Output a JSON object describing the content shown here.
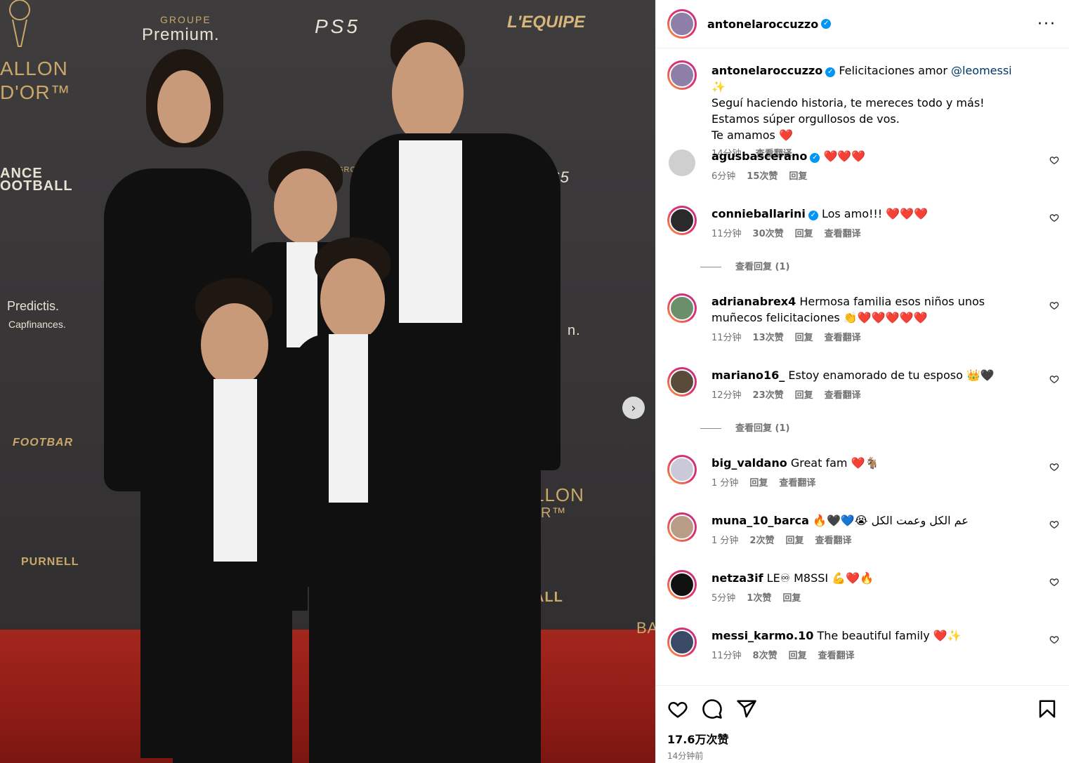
{
  "post": {
    "username": "antonelaroccuzzo",
    "more_icon": "more-horizontal-icon",
    "caption": {
      "username": "antonelaroccuzzo",
      "line1_text": "Felicitaciones amor",
      "mention": "@leomessi",
      "line1_emoji": "✨",
      "line2": "Seguí haciendo historia, te mereces todo y más!",
      "line3": "Estamos súper orgullosos de vos.",
      "line4_text": "Te amamos",
      "line4_emoji": "❤️",
      "time": "14分钟",
      "translate": "查看翻译"
    },
    "likes": "17.6万次赞",
    "timestamp": "14分钟前"
  },
  "photo": {
    "logos": {
      "groupe": "GROUPE",
      "premium": "Premium.",
      "ps5": "PS5",
      "lequipe": "L'EQUIPE",
      "ballon1": "ALLON",
      "ballon2": "D'OR™",
      "france1": "ANCE",
      "france2": "OOTBALL",
      "predictis": "Predictis.",
      "capfinances": "Capfinances.",
      "footbar": "FOOTBAR",
      "purnell": "PURNELL",
      "groupe_small": "GROUPE",
      "ps5_small": "S5",
      "n_dot": "n.",
      "ballon_r1": "LLON",
      "ballon_r2": "R™",
      "football_r1": "F",
      "football_r2": "ALL",
      "ba": "BA"
    }
  },
  "comments": [
    {
      "username": "agusbascerano",
      "verified": true,
      "text": "❤️❤️❤️",
      "time": "6分钟",
      "likes": "15次赞",
      "reply": "回复",
      "translate": ""
    },
    {
      "username": "connieballarini",
      "verified": true,
      "text": "Los amo!!! ❤️❤️❤️",
      "time": "11分钟",
      "likes": "30次赞",
      "reply": "回复",
      "translate": "查看翻译",
      "view_replies": "查看回复 (1)"
    },
    {
      "username": "adrianabrex4",
      "verified": false,
      "text": "Hermosa familia esos niños unos muñecos felicitaciones 👏❤️❤️❤️❤️❤️",
      "time": "11分钟",
      "likes": "13次赞",
      "reply": "回复",
      "translate": "查看翻译"
    },
    {
      "username": "mariano16_",
      "verified": false,
      "text": "Estoy enamorado de tu esposo 👑🖤",
      "time": "12分钟",
      "likes": "23次赞",
      "reply": "回复",
      "translate": "查看翻译",
      "view_replies": "查看回复 (1)"
    },
    {
      "username": "big_valdano",
      "verified": false,
      "text": "Great fam ❤️🐐",
      "time": "1 分钟",
      "likes": "",
      "reply": "回复",
      "translate": "查看翻译"
    },
    {
      "username": "muna_10_barca",
      "verified": false,
      "text": "🔥🖤💙😭 عم الكل وعمت الكل",
      "time": "1 分钟",
      "likes": "2次赞",
      "reply": "回复",
      "translate": "查看翻译"
    },
    {
      "username": "netza3if",
      "verified": false,
      "text": "LE♾ M8SSI 💪❤️🔥",
      "time": "5分钟",
      "likes": "1次赞",
      "reply": "回复",
      "translate": ""
    },
    {
      "username": "messi_karmo.10",
      "verified": false,
      "text": "The beautiful family ❤️✨",
      "time": "11分钟",
      "likes": "8次赞",
      "reply": "回复",
      "translate": "查看翻译"
    }
  ],
  "actions": {
    "like_icon": "heart-outline-icon",
    "comment_icon": "comment-bubble-icon",
    "share_icon": "paper-plane-icon",
    "save_icon": "bookmark-icon",
    "next_icon": "chevron-right-icon"
  }
}
